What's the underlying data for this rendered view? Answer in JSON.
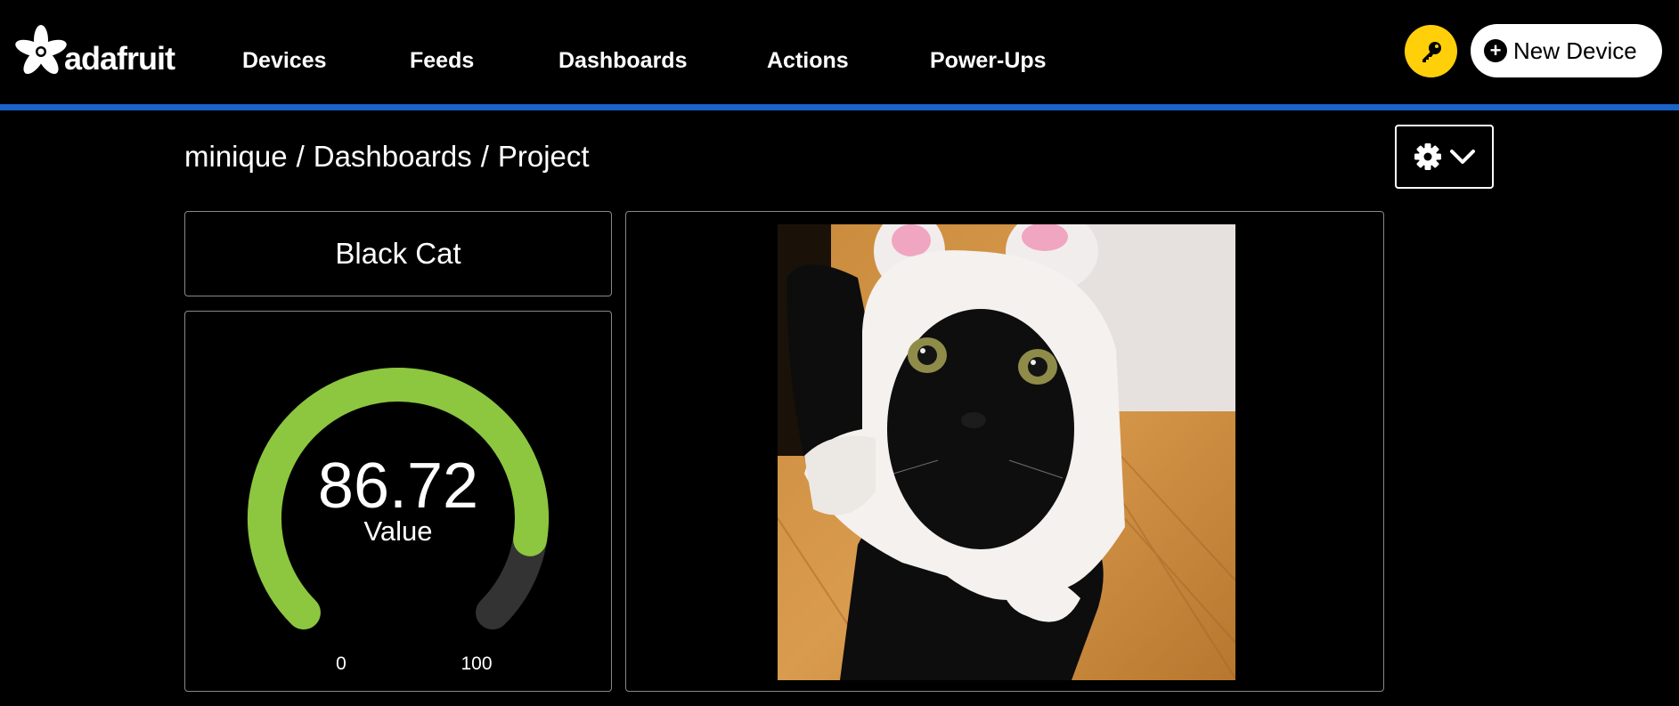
{
  "brand": {
    "name": "adafruit"
  },
  "nav": {
    "items": [
      {
        "label": "Devices"
      },
      {
        "label": "Feeds"
      },
      {
        "label": "Dashboards"
      },
      {
        "label": "Actions"
      },
      {
        "label": "Power-Ups"
      }
    ]
  },
  "header": {
    "key_icon": "key-icon",
    "new_device_label": "New Device"
  },
  "breadcrumb": {
    "user": "minique",
    "section": "Dashboards",
    "page": "Project",
    "separator": "/"
  },
  "settings": {
    "icon": "gear-icon",
    "chevron": "chevron-down-icon"
  },
  "blocks": {
    "text_block": {
      "label": "Black Cat"
    },
    "gauge": {
      "value": "86.72",
      "value_num": 86.72,
      "label": "Value",
      "min": "0",
      "max": "100",
      "min_num": 0,
      "max_num": 100,
      "fill_color": "#8dc63f",
      "track_color": "#333333"
    },
    "image": {
      "subject": "black cat wearing white bunny-ear hat"
    }
  },
  "colors": {
    "accent_bar": "#1a63c9",
    "key_button": "#ffcf0a",
    "gauge_fill": "#8dc63f"
  }
}
